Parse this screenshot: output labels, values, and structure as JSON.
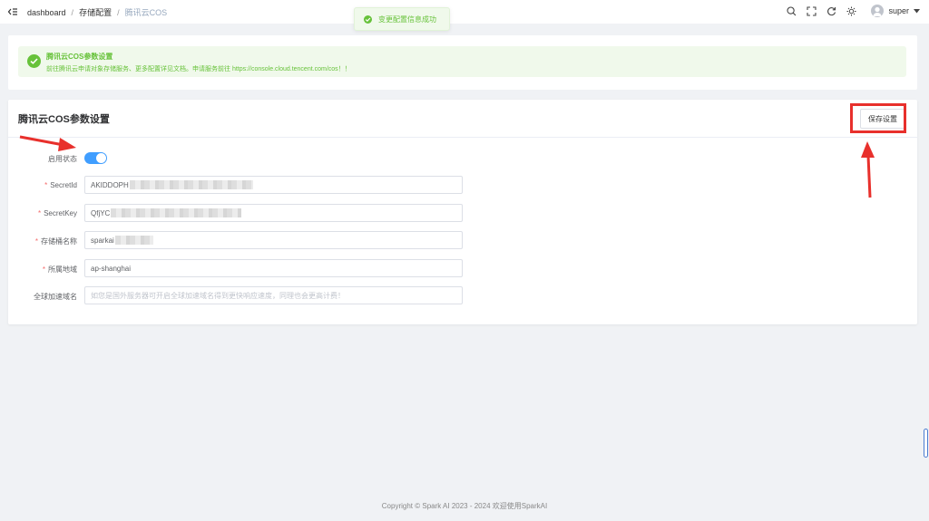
{
  "breadcrumb": {
    "items": [
      "dashboard",
      "存储配置",
      "腾讯云COS"
    ]
  },
  "toast": {
    "message": "变更配置信息成功"
  },
  "header": {
    "username": "super"
  },
  "alert": {
    "title": "腾讯云COS参数设置",
    "description": "前往腾讯云申请对象存储服务、更多配置详见文档。申请服务前往 https://console.cloud.tencent.com/cos！！"
  },
  "panel": {
    "title": "腾讯云COS参数设置",
    "save_label": "保存设置"
  },
  "form": {
    "status_label": "启用状态",
    "status_enabled": true,
    "secret_id_label": "SecretId",
    "secret_id_value": "AKIDDOPH",
    "secret_key_label": "SecretKey",
    "secret_key_value": "QfjYC",
    "bucket_label": "存储桶名称",
    "bucket_value": "sparkai",
    "region_label": "所属地域",
    "region_value": "ap-shanghai",
    "cdn_label": "全球加速域名",
    "cdn_placeholder": "如您是国外服务器可开启全球加速域名得到更快响应速度，同理也会更高计费！"
  },
  "footer": {
    "copyright": "Copyright © Spark AI  2023 - 2024  欢迎使用SparkAI"
  },
  "colors": {
    "accent": "#409eff",
    "success": "#67c23a",
    "annotation": "#e8302c"
  },
  "icons": [
    "menu-fold-icon",
    "search-icon",
    "fullscreen-icon",
    "refresh-icon",
    "theme-icon",
    "user-avatar-icon",
    "caret-down-icon",
    "check-circle-icon"
  ]
}
